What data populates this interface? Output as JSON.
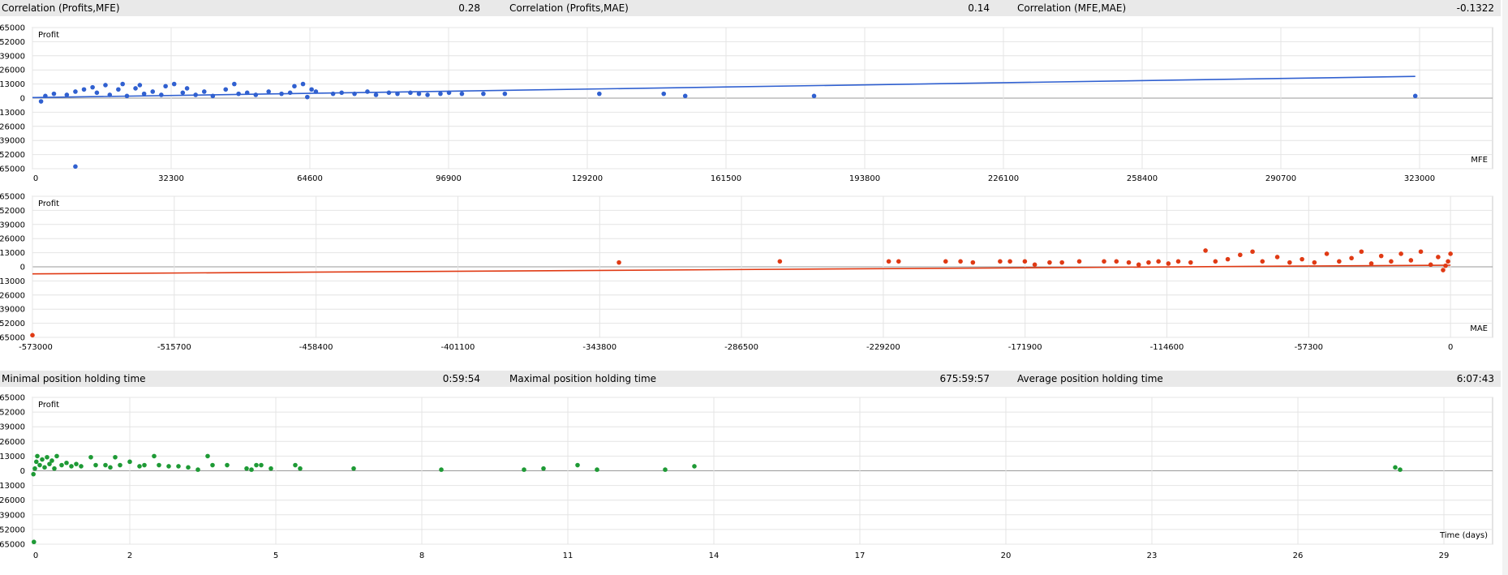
{
  "stats_top": [
    {
      "label": "Correlation (Profits,MFE)",
      "value": "0.28"
    },
    {
      "label": "Correlation (Profits,MAE)",
      "value": "0.14"
    },
    {
      "label": "Correlation (MFE,MAE)",
      "value": "-0.1322"
    }
  ],
  "stats_mid": [
    {
      "label": "Minimal position holding time",
      "value": "0:59:54"
    },
    {
      "label": "Maximal position holding time",
      "value": "675:59:57"
    },
    {
      "label": "Average position holding time",
      "value": "6:07:43"
    }
  ],
  "colors": {
    "mfe": "#3060d0",
    "mae": "#e03a14",
    "time": "#1e9a35"
  },
  "chart_data": [
    {
      "type": "scatter",
      "ylabel": "Profit",
      "xlabel": "MFE",
      "yticks": [
        65000,
        52000,
        39000,
        26000,
        13000,
        0,
        -13000,
        -26000,
        -39000,
        -52000,
        -65000
      ],
      "xticks": [
        0,
        32300,
        64600,
        96900,
        129200,
        161500,
        193800,
        226100,
        258400,
        290700,
        323000
      ],
      "xlim": [
        0,
        340000
      ],
      "ylim": [
        -65000,
        65000
      ],
      "grid": true,
      "series": [
        {
          "points": [
            [
              2000,
              -3000
            ],
            [
              3000,
              2000
            ],
            [
              5000,
              4000
            ],
            [
              8000,
              3000
            ],
            [
              10000,
              6000
            ],
            [
              12000,
              8000
            ],
            [
              14000,
              10000
            ],
            [
              15000,
              5000
            ],
            [
              17000,
              12000
            ],
            [
              18000,
              3000
            ],
            [
              20000,
              8000
            ],
            [
              21000,
              13000
            ],
            [
              22000,
              2000
            ],
            [
              24000,
              9000
            ],
            [
              25000,
              12000
            ],
            [
              26000,
              4000
            ],
            [
              28000,
              6000
            ],
            [
              30000,
              3000
            ],
            [
              31000,
              11000
            ],
            [
              33000,
              13000
            ],
            [
              35000,
              5000
            ],
            [
              36000,
              9000
            ],
            [
              38000,
              3000
            ],
            [
              40000,
              6000
            ],
            [
              42000,
              2000
            ],
            [
              45000,
              8000
            ],
            [
              47000,
              13000
            ],
            [
              48000,
              4000
            ],
            [
              50000,
              5000
            ],
            [
              52000,
              3000
            ],
            [
              55000,
              6000
            ],
            [
              58000,
              4000
            ],
            [
              60000,
              5000
            ],
            [
              61000,
              11000
            ],
            [
              63000,
              13000
            ],
            [
              64000,
              1000
            ],
            [
              65000,
              8000
            ],
            [
              66000,
              6000
            ],
            [
              70000,
              4000
            ],
            [
              72000,
              5000
            ],
            [
              75000,
              4000
            ],
            [
              78000,
              6000
            ],
            [
              80000,
              3000
            ],
            [
              83000,
              5000
            ],
            [
              85000,
              4000
            ],
            [
              88000,
              5000
            ],
            [
              90000,
              4000
            ],
            [
              92000,
              3000
            ],
            [
              95000,
              4000
            ],
            [
              97000,
              5000
            ],
            [
              100000,
              4000
            ],
            [
              105000,
              4000
            ],
            [
              110000,
              4000
            ],
            [
              132000,
              4000
            ],
            [
              147000,
              4000
            ],
            [
              152000,
              2000
            ],
            [
              182000,
              2000
            ],
            [
              322000,
              2000
            ],
            [
              10000,
              -63000
            ]
          ]
        }
      ],
      "trend": [
        [
          0,
          500
        ],
        [
          322000,
          20000
        ]
      ]
    },
    {
      "type": "scatter",
      "ylabel": "Profit",
      "xlabel": "MAE",
      "yticks": [
        65000,
        52000,
        39000,
        26000,
        13000,
        0,
        -13000,
        -26000,
        -39000,
        -52000,
        -65000
      ],
      "xticks": [
        -573000,
        -515700,
        -458400,
        -401100,
        -343800,
        -286500,
        -229200,
        -171900,
        -114600,
        -57300,
        0
      ],
      "xlim": [
        -573000,
        17000
      ],
      "ylim": [
        -65000,
        65000
      ],
      "grid": true,
      "series": [
        {
          "points": [
            [
              -573000,
              -63000
            ],
            [
              -336000,
              4000
            ],
            [
              -271000,
              5000
            ],
            [
              -227000,
              5000
            ],
            [
              -223000,
              5000
            ],
            [
              -204000,
              5000
            ],
            [
              -198000,
              5000
            ],
            [
              -193000,
              4000
            ],
            [
              -182000,
              5000
            ],
            [
              -178000,
              5000
            ],
            [
              -172000,
              5000
            ],
            [
              -168000,
              2000
            ],
            [
              -162000,
              4000
            ],
            [
              -157000,
              4000
            ],
            [
              -150000,
              5000
            ],
            [
              -140000,
              5000
            ],
            [
              -135000,
              5000
            ],
            [
              -130000,
              4000
            ],
            [
              -126000,
              2000
            ],
            [
              -122000,
              4000
            ],
            [
              -118000,
              5000
            ],
            [
              -114000,
              3000
            ],
            [
              -110000,
              5000
            ],
            [
              -105000,
              4000
            ],
            [
              -99000,
              15000
            ],
            [
              -95000,
              5000
            ],
            [
              -90000,
              7000
            ],
            [
              -85000,
              11000
            ],
            [
              -80000,
              14000
            ],
            [
              -76000,
              5000
            ],
            [
              -70000,
              9000
            ],
            [
              -65000,
              4000
            ],
            [
              -60000,
              7000
            ],
            [
              -55000,
              4000
            ],
            [
              -50000,
              12000
            ],
            [
              -45000,
              5000
            ],
            [
              -40000,
              8000
            ],
            [
              -36000,
              14000
            ],
            [
              -32000,
              3000
            ],
            [
              -28000,
              10000
            ],
            [
              -24000,
              5000
            ],
            [
              -20000,
              12000
            ],
            [
              -16000,
              6000
            ],
            [
              -12000,
              14000
            ],
            [
              -8000,
              2000
            ],
            [
              -5000,
              9000
            ],
            [
              -3000,
              -3000
            ],
            [
              -1000,
              5000
            ],
            [
              0,
              12000
            ],
            [
              -2000,
              1000
            ]
          ]
        }
      ],
      "trend": [
        [
          -573000,
          -6500
        ],
        [
          0,
          1500
        ]
      ]
    },
    {
      "type": "scatter",
      "ylabel": "Profit",
      "xlabel": "Time (days)",
      "yticks": [
        65000,
        52000,
        39000,
        26000,
        13000,
        0,
        -13000,
        -26000,
        -39000,
        -52000,
        -65000
      ],
      "xticks": [
        "0",
        "2",
        "5",
        "8",
        "11",
        "14",
        "17",
        "20",
        "23",
        "26",
        "29"
      ],
      "xlim": [
        0,
        30
      ],
      "ylim": [
        -65000,
        65000
      ],
      "grid": true,
      "series": [
        {
          "points": [
            [
              0.02,
              -3000
            ],
            [
              0.05,
              2000
            ],
            [
              0.08,
              8000
            ],
            [
              0.1,
              13000
            ],
            [
              0.15,
              5000
            ],
            [
              0.2,
              10000
            ],
            [
              0.25,
              3000
            ],
            [
              0.3,
              12000
            ],
            [
              0.35,
              6000
            ],
            [
              0.4,
              9000
            ],
            [
              0.45,
              2000
            ],
            [
              0.5,
              13000
            ],
            [
              0.6,
              5000
            ],
            [
              0.7,
              7000
            ],
            [
              0.8,
              4000
            ],
            [
              0.9,
              6000
            ],
            [
              1.0,
              4000
            ],
            [
              1.2,
              12000
            ],
            [
              1.3,
              5000
            ],
            [
              1.5,
              5000
            ],
            [
              1.6,
              3000
            ],
            [
              1.7,
              12000
            ],
            [
              1.8,
              5000
            ],
            [
              2.0,
              8000
            ],
            [
              2.2,
              4000
            ],
            [
              2.3,
              5000
            ],
            [
              2.5,
              13000
            ],
            [
              2.6,
              5000
            ],
            [
              2.8,
              4000
            ],
            [
              3.0,
              4000
            ],
            [
              3.2,
              3000
            ],
            [
              3.4,
              1000
            ],
            [
              3.6,
              13000
            ],
            [
              3.7,
              5000
            ],
            [
              4.0,
              5000
            ],
            [
              4.4,
              2000
            ],
            [
              4.5,
              1000
            ],
            [
              4.6,
              5000
            ],
            [
              4.7,
              5000
            ],
            [
              4.9,
              2000
            ],
            [
              5.4,
              5000
            ],
            [
              5.5,
              2000
            ],
            [
              6.6,
              2000
            ],
            [
              8.4,
              1000
            ],
            [
              10.1,
              1000
            ],
            [
              10.5,
              2000
            ],
            [
              11.2,
              5000
            ],
            [
              11.6,
              1000
            ],
            [
              13.0,
              1000
            ],
            [
              13.6,
              4000
            ],
            [
              28.0,
              3000
            ],
            [
              28.1,
              1000
            ],
            [
              0.03,
              -63000
            ]
          ]
        }
      ],
      "trend": null
    }
  ]
}
